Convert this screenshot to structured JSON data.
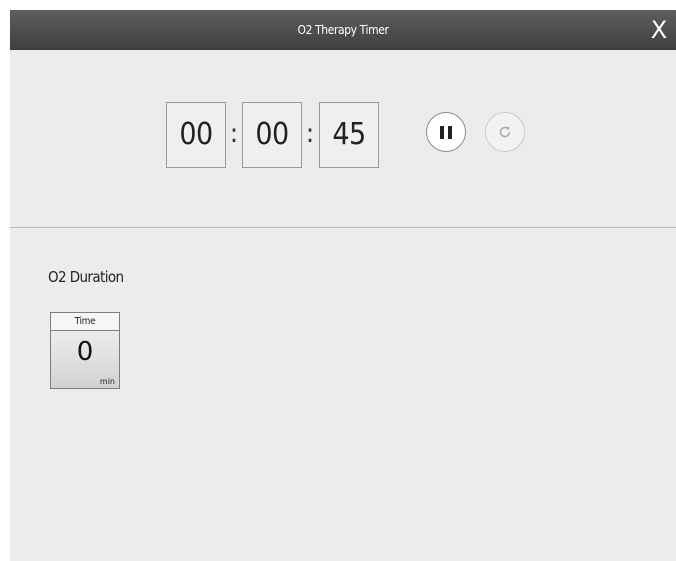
{
  "window": {
    "title": "O2 Therapy Timer",
    "close_label": "X"
  },
  "timer": {
    "hours": "00",
    "minutes": "00",
    "seconds": "45",
    "separator": ":",
    "pause_icon": "pause-icon",
    "reset_icon": "reset-icon"
  },
  "duration": {
    "section_title": "O2 Duration",
    "tile_label": "Time",
    "value": "0",
    "unit": "min"
  }
}
